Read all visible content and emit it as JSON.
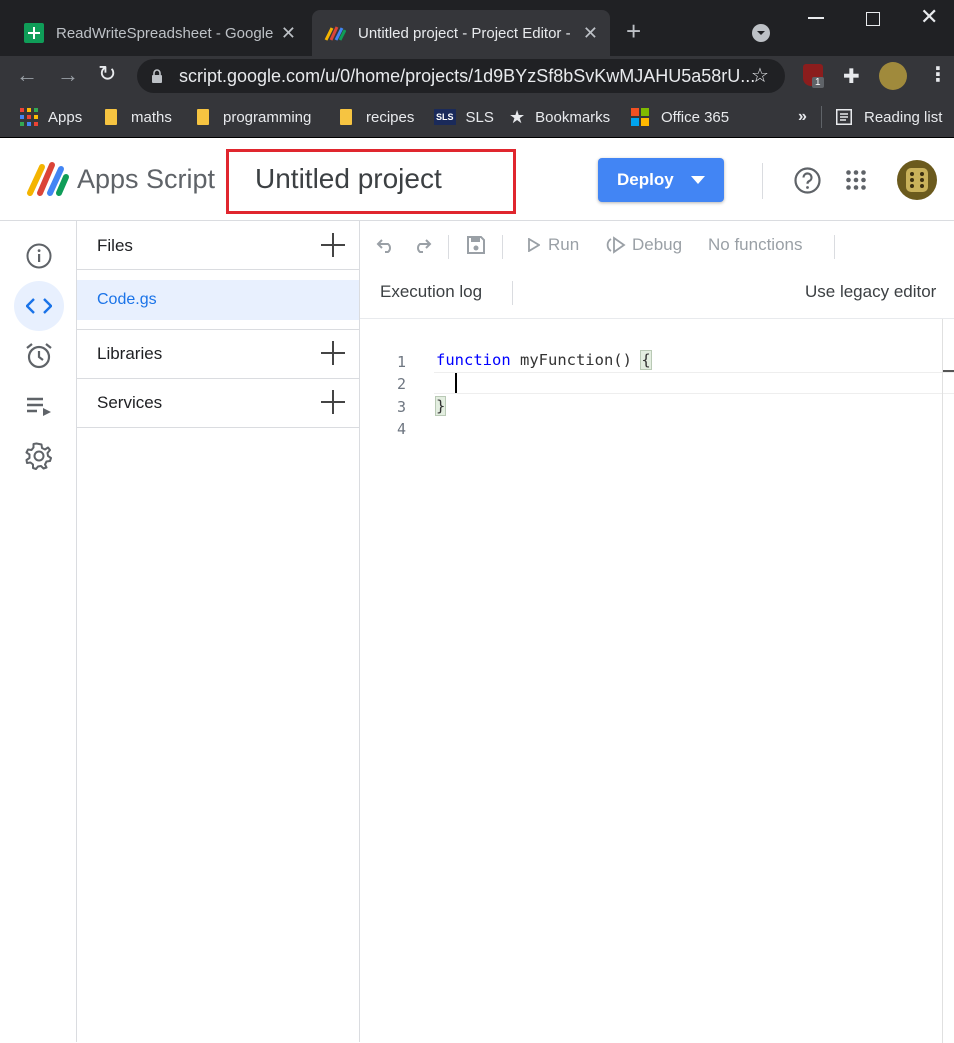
{
  "browser": {
    "tabs": [
      {
        "title": "ReadWriteSpreadsheet - Google",
        "active": false
      },
      {
        "title": "Untitled project - Project Editor -",
        "active": true
      }
    ],
    "url": "script.google.com/u/0/home/projects/1d9BYzSf8bSvKwMJAHU5a58rU...",
    "bookmarks": [
      {
        "label": "Apps"
      },
      {
        "label": "maths"
      },
      {
        "label": "programming"
      },
      {
        "label": "recipes"
      },
      {
        "label": "SLS",
        "badge": "SLS"
      },
      {
        "label": "Bookmarks"
      },
      {
        "label": "Office 365"
      }
    ],
    "overflow": "»",
    "reading_list": "Reading list",
    "extension_badge": "1"
  },
  "header": {
    "app_name": "Apps Script",
    "project_title": "Untitled project",
    "deploy_label": "Deploy",
    "highlight_color": "#e0262e"
  },
  "files_panel": {
    "files_label": "Files",
    "files": [
      "Code.gs"
    ],
    "libraries_label": "Libraries",
    "services_label": "Services"
  },
  "editor": {
    "run_label": "Run",
    "debug_label": "Debug",
    "functions_label": "No functions",
    "execution_log_label": "Execution log",
    "legacy_label": "Use legacy editor",
    "line_numbers": [
      "1",
      "2",
      "3",
      "4"
    ],
    "code": {
      "keyword": "function",
      "signature": " myFunction() ",
      "open_brace": "{",
      "close_brace": "}"
    }
  },
  "colors": {
    "accent": "#4285f4",
    "active_file_bg": "#e8f0fe",
    "active_file_text": "#1a73e8"
  }
}
